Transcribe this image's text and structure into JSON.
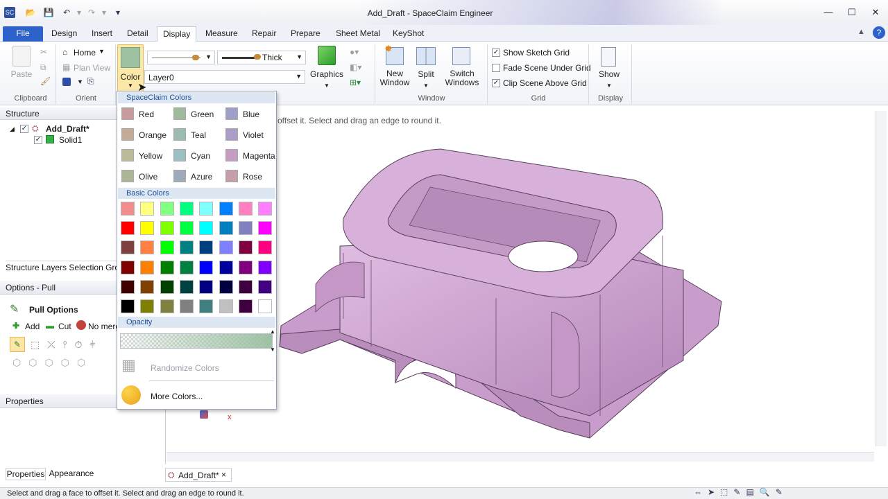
{
  "window": {
    "title": "Add_Draft - SpaceClaim Engineer"
  },
  "tabs": [
    "File",
    "Design",
    "Insert",
    "Detail",
    "Display",
    "Measure",
    "Repair",
    "Prepare",
    "Sheet Metal",
    "KeyShot"
  ],
  "ribbon": {
    "clipboard": {
      "paste": "Paste",
      "label": "Clipboard"
    },
    "orient": {
      "home": "Home",
      "plan_view": "Plan View",
      "label": "Orient"
    },
    "style": {
      "color": "Color",
      "line_weight": "Thick",
      "layer": "Layer0",
      "graphics": "Graphics"
    },
    "window": {
      "new_window": "New Window",
      "split": "Split",
      "switch_windows": "Switch Windows",
      "label": "Window"
    },
    "grid": {
      "show_sketch_grid": "Show Sketch Grid",
      "fade_scene": "Fade Scene Under Grid",
      "clip_scene": "Clip Scene Above Grid",
      "label": "Grid",
      "checked": [
        true,
        false,
        true
      ]
    },
    "display": {
      "show": "Show",
      "label": "Display"
    }
  },
  "structure": {
    "title": "Structure",
    "items": [
      {
        "label": "Add_Draft*"
      },
      {
        "label": "Solid1"
      }
    ],
    "bottom_tabs": "Structure  Layers  Selection  Grou"
  },
  "options": {
    "title": "Options - Pull",
    "pull_options": "Pull Options",
    "add": "Add",
    "cut": "Cut",
    "no_merge": "No merg"
  },
  "properties": {
    "title": "Properties",
    "tabs": [
      "Properties",
      "Appearance"
    ]
  },
  "viewport": {
    "hint": "offset it. Select and drag an edge to round it.",
    "doc_tab": "Add_Draft*",
    "axis_x": "x",
    "model_color": "#cf9fd2"
  },
  "dropdown": {
    "spaceclaim_header": "SpaceClaim Colors",
    "spaceclaim_colors": [
      {
        "name": "Red",
        "hex": "#c79b9e"
      },
      {
        "name": "Green",
        "hex": "#9fba9d"
      },
      {
        "name": "Blue",
        "hex": "#9ea0c8"
      },
      {
        "name": "Orange",
        "hex": "#c2ab99"
      },
      {
        "name": "Teal",
        "hex": "#9cbcb2"
      },
      {
        "name": "Violet",
        "hex": "#ab9fc6"
      },
      {
        "name": "Yellow",
        "hex": "#b9bb99"
      },
      {
        "name": "Cyan",
        "hex": "#9ebfbf"
      },
      {
        "name": "Magenta",
        "hex": "#c39dc2"
      },
      {
        "name": "Olive",
        "hex": "#abb696"
      },
      {
        "name": "Azure",
        "hex": "#9ea9b9"
      },
      {
        "name": "Rose",
        "hex": "#c49ea8"
      }
    ],
    "basic_header": "Basic Colors",
    "basic_colors": [
      [
        "#f28b8b",
        "#ffff80",
        "#80ff80",
        "#00ff80",
        "#80ffff",
        "#0080ff",
        "#ff80c0",
        "#ff80ff"
      ],
      [
        "#ff0000",
        "#ffff00",
        "#80ff00",
        "#00ff40",
        "#00ffff",
        "#0080c0",
        "#8080c0",
        "#ff00ff"
      ],
      [
        "#804040",
        "#ff8040",
        "#00ff00",
        "#008080",
        "#004080",
        "#8080ff",
        "#800040",
        "#ff0080"
      ],
      [
        "#800000",
        "#ff8000",
        "#008000",
        "#008040",
        "#0000ff",
        "#0000a0",
        "#800080",
        "#8000ff"
      ],
      [
        "#400000",
        "#804000",
        "#004000",
        "#004040",
        "#000080",
        "#000040",
        "#400040",
        "#400080"
      ],
      [
        "#000000",
        "#808000",
        "#808040",
        "#808080",
        "#408080",
        "#c0c0c0",
        "#400040",
        "#ffffff"
      ]
    ],
    "opacity_header": "Opacity",
    "randomize": "Randomize Colors",
    "more_colors": "More Colors..."
  },
  "status": {
    "text": "Select and drag a face to offset it. Select and drag an edge to round it."
  }
}
